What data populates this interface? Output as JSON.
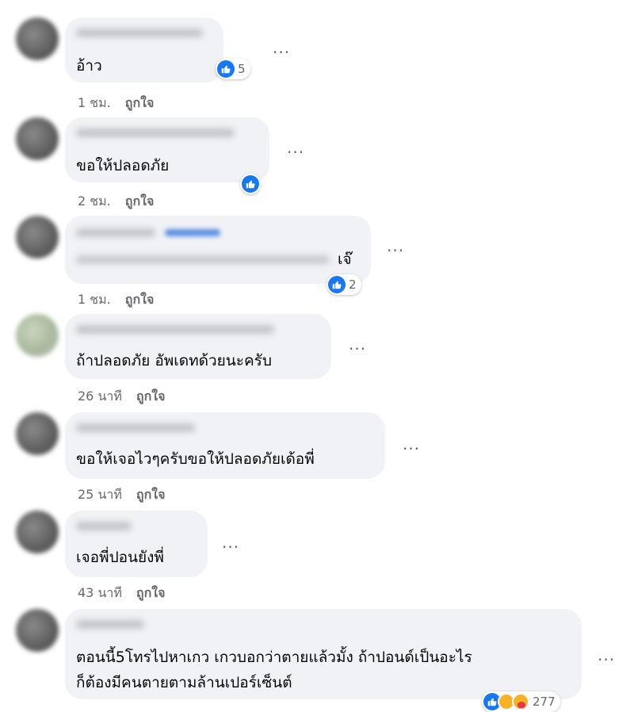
{
  "ui": {
    "more_glyph": "···",
    "like_action": "ถูกใจ"
  },
  "comments": [
    {
      "text": "อ้าว",
      "time": "1 ชม.",
      "reaction_count": "5"
    },
    {
      "text": "ขอให้ปลอดภัย",
      "time": "2 ชม.",
      "reaction_count": ""
    },
    {
      "text": "เจ๊",
      "time": "1 ชม.",
      "reaction_count": "2"
    },
    {
      "text": "ถ้าปลอดภัย อัพเดทด้วยนะครับ",
      "time": "26 นาที",
      "reaction_count": ""
    },
    {
      "text": "ขอให้เจอไวๆครับขอให้ปลอดภัยเด้อพี่",
      "time": "25 นาที",
      "reaction_count": ""
    },
    {
      "text": "เจอพี่ปอนยังพี่",
      "time": "43 นาที",
      "reaction_count": ""
    },
    {
      "text_line1": "ตอนนี้5โทรไปหาเกว เกวบอกว่าตายแล้วมั้ง ถ้าปอนด์เป็นอะไร",
      "text_line2": "ก็ต้องมีคนตายตามล้านเปอร์เซ็นต์",
      "time": "",
      "reaction_count": "277"
    }
  ],
  "colors": {
    "bubble": "#f0f2f5",
    "meta_text": "#65676b",
    "like_blue": "#1877f2"
  }
}
